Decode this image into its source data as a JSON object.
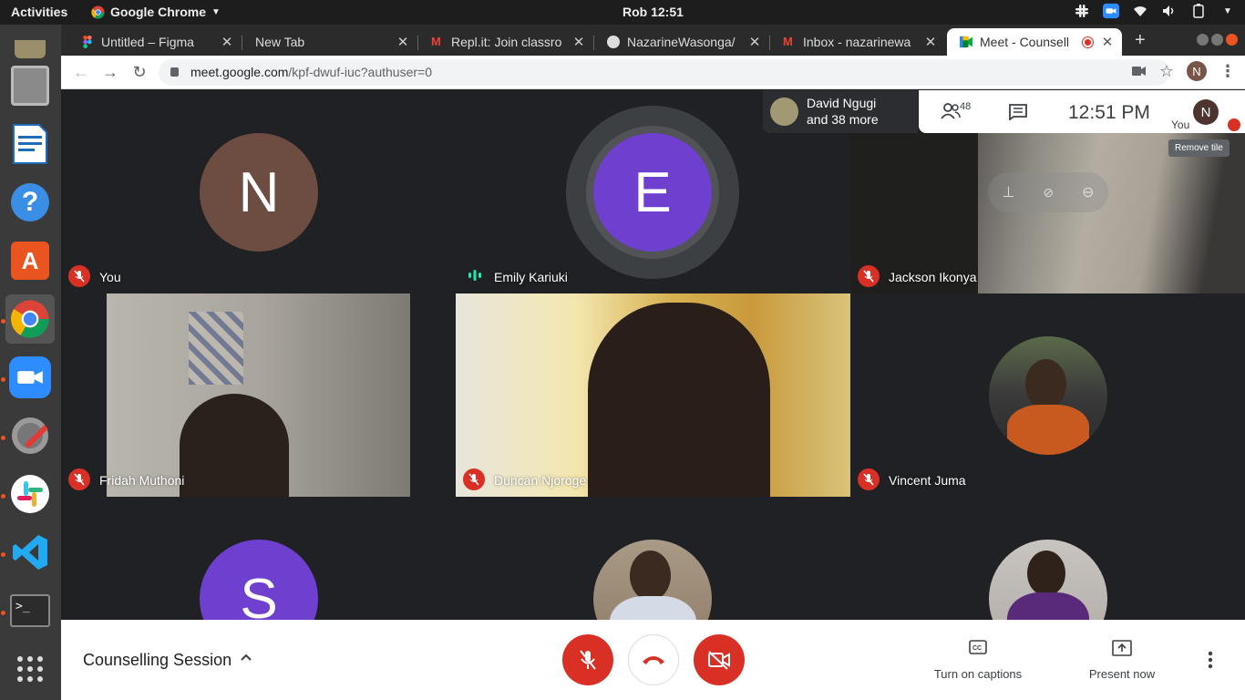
{
  "system": {
    "activities": "Activities",
    "app_name": "Google Chrome",
    "clock": "Rob 12:51"
  },
  "dock": {
    "items": [
      "audio-app-icon",
      "files-icon",
      "writer-icon",
      "help-icon",
      "software-center-icon",
      "chrome-icon",
      "zoom-icon",
      "settings-icon",
      "slack-icon",
      "vscode-icon",
      "terminal-icon",
      "show-apps-icon"
    ]
  },
  "tabs": [
    {
      "title": "Untitled – Figma"
    },
    {
      "title": "New Tab"
    },
    {
      "title": "Repl.it: Join classro"
    },
    {
      "title": "NazarineWasonga/"
    },
    {
      "title": "Inbox - nazarinewa"
    },
    {
      "title": "Meet - Counsell"
    }
  ],
  "address": {
    "host": "meet.google.com",
    "path": "/kpf-dwuf-iuc?authuser=0",
    "profile_initial": "N"
  },
  "meet": {
    "people_chip": {
      "line1": "David Ngugi",
      "line2": "and 38 more"
    },
    "participant_count": "48",
    "time": "12:51  PM",
    "self_label": "You",
    "self_initial": "N",
    "tooltip": "Remove tile",
    "tiles": [
      {
        "name": "You",
        "initial": "N",
        "avatar_color": "#6d4c41",
        "state": "muted"
      },
      {
        "name": "Emily Kariuki",
        "initial": "E",
        "avatar_color": "#6f3fcf",
        "state": "speaking"
      },
      {
        "name": "Jackson Ikonya",
        "state": "muted"
      },
      {
        "name": "Fridah Muthoni",
        "state": "muted"
      },
      {
        "name": "Duncan Njoroge",
        "state": "muted"
      },
      {
        "name": "Vincent Juma",
        "state": "muted"
      },
      {
        "initial": "S",
        "avatar_color": "#6f3fcf"
      }
    ]
  },
  "bottom": {
    "meeting_title": "Counselling Session",
    "captions_label": "Turn on captions",
    "present_label": "Present now"
  },
  "colors": {
    "accent_red": "#d93025",
    "meet_bg": "#202124",
    "speaking": "#1de9b6"
  }
}
